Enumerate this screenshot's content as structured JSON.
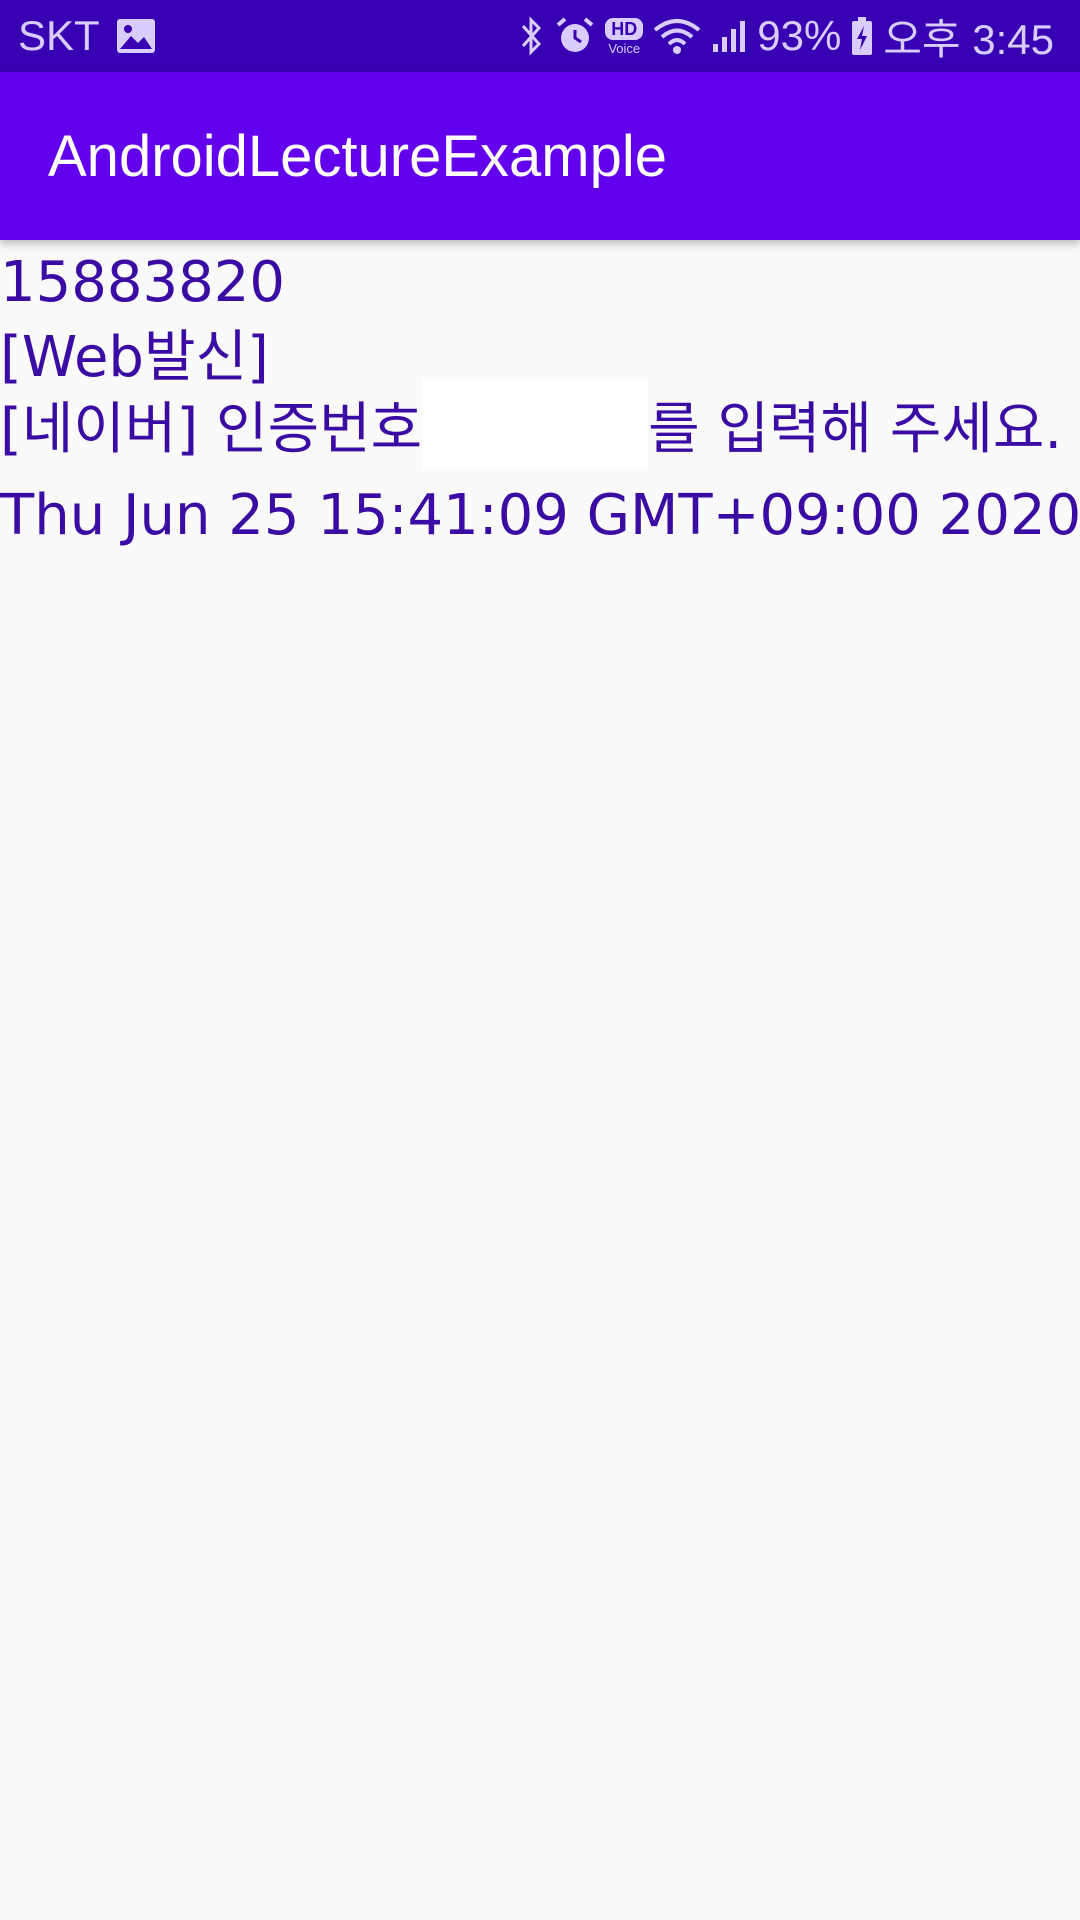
{
  "status_bar": {
    "carrier": "SKT",
    "hd_badge": "HD",
    "voice_badge": "Voice",
    "battery_percent": "93%",
    "time": "오후 3:45",
    "icons": [
      "image-icon",
      "bluetooth-icon",
      "alarm-icon",
      "hd-voice-icon",
      "wifi-icon",
      "signal-icon",
      "battery-charging-icon"
    ]
  },
  "app_bar": {
    "title": "AndroidLectureExample"
  },
  "sms": {
    "sender": "15883820",
    "body_line1": "[Web발신]",
    "body_line2_prefix": "[네이버] 인증번호",
    "body_line2_suffix": "를 입력해 주세요.",
    "received_at": "Thu Jun 25 15:41:09 GMT+09:00 2020"
  },
  "colors": {
    "status_bar_bg": "#3700b3",
    "app_bar_bg": "#6200ee",
    "text": "#3a0ca3",
    "page_bg": "#fafafa"
  }
}
